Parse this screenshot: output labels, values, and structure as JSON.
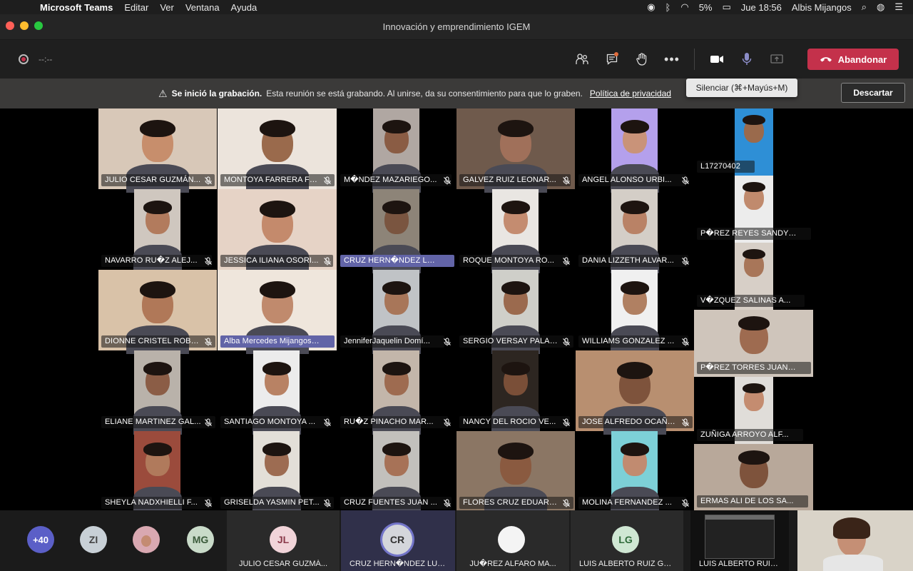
{
  "menubar": {
    "app": "Microsoft Teams",
    "menus": [
      "Editar",
      "Ver",
      "Ventana",
      "Ayuda"
    ],
    "battery": "5%",
    "datetime": "Jue 18:56",
    "user": "Albis Mijangos"
  },
  "window": {
    "title": "Innovación y emprendimiento IGEM"
  },
  "toolbar": {
    "timer": "--:--",
    "leave_label": "Abandonar"
  },
  "banner": {
    "bold": "Se inició la grabación.",
    "text": "Esta reunión se está grabando. Al unirse, da su consentimiento para que lo graben.",
    "link": "Política de privacidad",
    "dismiss": "Descartar"
  },
  "tooltip": "Silenciar (⌘+Mayús+M)",
  "participants": [
    "JULIO CESAR GUZMÁN...",
    "MONTOYA FARRERA FER...",
    "M�NDEZ MAZARIEGO...",
    "GALVEZ RUIZ LEONAR...",
    "ANGEL ALONSO URBI...",
    "NAVARRO RU�Z ALEJ...",
    "JESSICA ILIANA OSORI...",
    "CRUZ HERN�NDEZ LUIS ...",
    "ROQUE MONTOYA RO...",
    "DANIA LIZZETH ALVAR...",
    "DIONNE CRISTEL ROBL...",
    "Alba Mercedes Mijangos ...",
    "JenniferJaquelin Domí...",
    "SERGIO VERSAY PALAC...",
    "WILLIAMS GONZALEZ ...",
    "ELIANE MARTINEZ GAL...",
    "SANTIAGO MONTOYA ...",
    "RU�Z PINACHO MAR...",
    "NANCY DEL ROCIO VE...",
    "JOSE ALFREDO OCAÑA...",
    "SHEYLA NADXHIELLI F...",
    "GRISELDA YASMIN PET...",
    "CRUZ FUENTES JUAN ...",
    "FLORES CRUZ EDUARDO",
    "MOLINA FERNANDEZ ..."
  ],
  "side_participants": [
    "L17270402",
    "P�REZ REYES SANDY ...",
    "V�ZQUEZ SALINAS A...",
    "P�REZ TORRES JUAN ...",
    "ZUÑIGA ARROYO ALF...",
    "ERMAS ALI DE LOS SA..."
  ],
  "strip": {
    "overflow": "+40",
    "avatars": [
      "ZI",
      "MG"
    ],
    "tiles": [
      {
        "initials": "JL",
        "name": "JULIO CESAR GUZMÁ..."
      },
      {
        "initials": "CR",
        "name": "CRUZ HERN�NDEZ LUIS ..."
      },
      {
        "initials": "",
        "name": "JU�REZ ALFARO MA..."
      },
      {
        "initials": "LG",
        "name": "LUIS ALBERTO RUIZ GOMEZ"
      }
    ],
    "share_name": "LUIS ALBERTO RUIZ GOMEZ"
  },
  "colors": {
    "accent": "#6264a7",
    "leave": "#c4314b"
  }
}
